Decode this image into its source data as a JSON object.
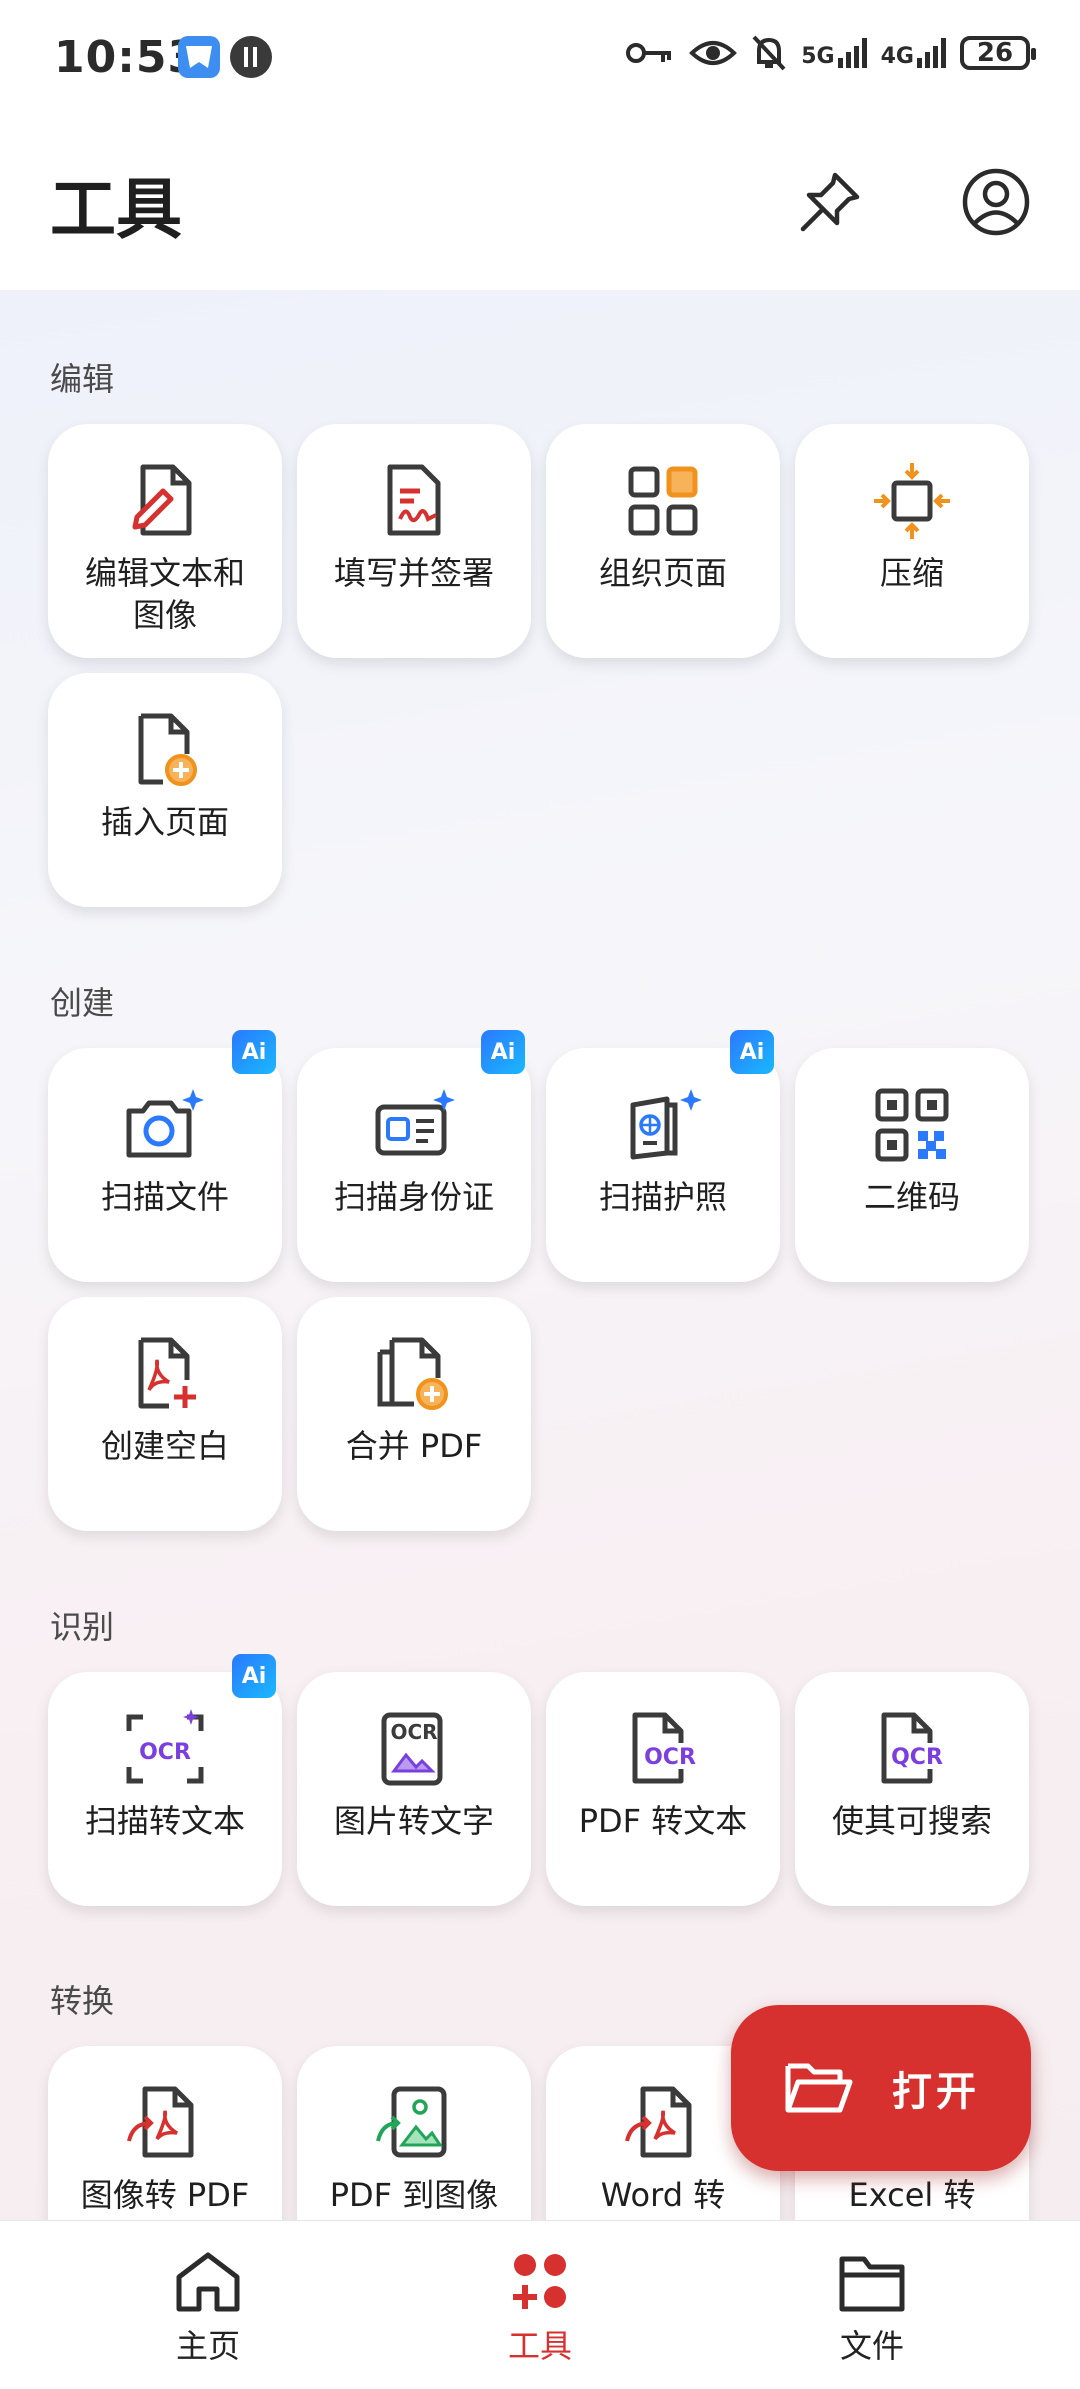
{
  "status_bar": {
    "time": "10:53",
    "signal_5g": "5G",
    "signal_4g": "4G",
    "battery": "26",
    "icons": [
      "vpn-key-icon",
      "eye-icon",
      "bell-off-icon",
      "signal-5g-icon",
      "signal-4g-icon",
      "battery-icon"
    ]
  },
  "header": {
    "title": "工具"
  },
  "sections": {
    "edit": {
      "title": "编辑",
      "items": [
        {
          "label": "编辑文本和\n图像",
          "icon": "edit-document-icon"
        },
        {
          "label": "填写并签署",
          "icon": "fill-sign-icon"
        },
        {
          "label": "组织页面",
          "icon": "organize-pages-icon"
        },
        {
          "label": "压缩",
          "icon": "compress-icon"
        },
        {
          "label": "插入页面",
          "icon": "insert-page-icon"
        }
      ]
    },
    "create": {
      "title": "创建",
      "items": [
        {
          "label": "扫描文件",
          "icon": "camera-scan-icon",
          "badge": "Ai"
        },
        {
          "label": "扫描身份证",
          "icon": "id-card-scan-icon",
          "badge": "Ai"
        },
        {
          "label": "扫描护照",
          "icon": "passport-scan-icon",
          "badge": "Ai"
        },
        {
          "label": "二维码",
          "icon": "qr-code-icon"
        },
        {
          "label": "创建空白",
          "icon": "create-blank-pdf-icon"
        },
        {
          "label": "合并 PDF",
          "icon": "merge-pdf-icon"
        }
      ]
    },
    "recognize": {
      "title": "识别",
      "items": [
        {
          "label": "扫描转文本",
          "icon": "ocr-scan-icon",
          "badge": "Ai"
        },
        {
          "label": "图片转文字",
          "icon": "image-ocr-icon"
        },
        {
          "label": "PDF 转文本",
          "icon": "pdf-ocr-icon"
        },
        {
          "label": "使其可搜索",
          "icon": "searchable-ocr-icon"
        }
      ]
    },
    "convert": {
      "title": "转换",
      "items": [
        {
          "label": "图像转 PDF",
          "icon": "image-to-pdf-icon"
        },
        {
          "label": "PDF 到图像",
          "icon": "pdf-to-image-icon"
        },
        {
          "label": "Word 转",
          "icon": "word-to-pdf-icon"
        },
        {
          "label": "Excel 转",
          "icon": "excel-to-pdf-icon"
        }
      ]
    }
  },
  "fab": {
    "label": "打开"
  },
  "bottom_nav": {
    "items": [
      {
        "label": "主页",
        "icon": "home-icon"
      },
      {
        "label": "工具",
        "icon": "tools-icon",
        "active": true
      },
      {
        "label": "文件",
        "icon": "folder-icon"
      }
    ]
  },
  "colors": {
    "accent": "#d6302f",
    "ai_badge": "#2b79ff",
    "ocr_purple": "#7b3fe0",
    "orange": "#f0921c"
  }
}
